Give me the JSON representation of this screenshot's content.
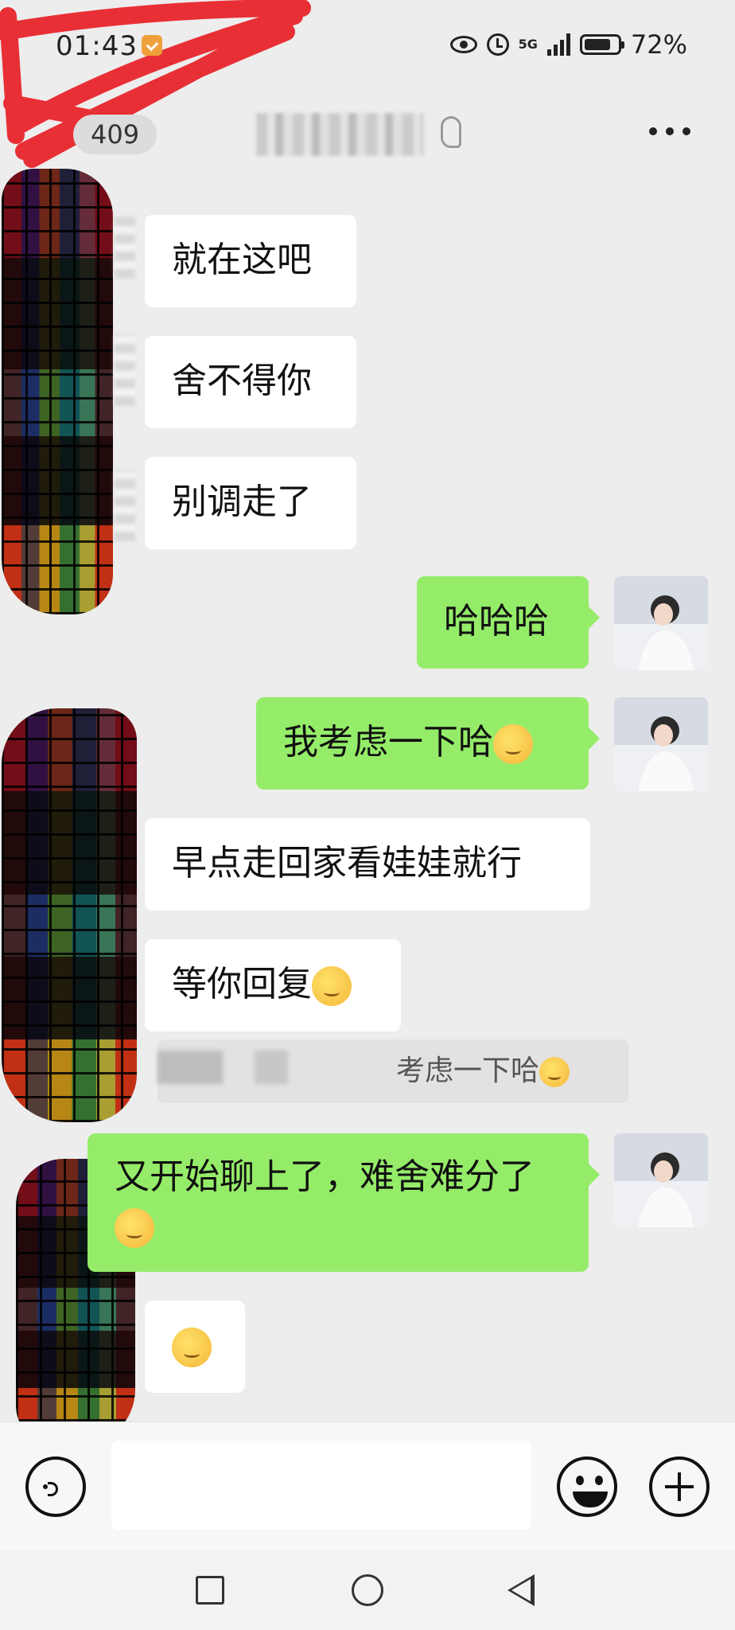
{
  "status_bar": {
    "time": "01:43",
    "network": "5G",
    "battery": "72%",
    "icons": [
      "badge-icon",
      "eye-icon",
      "alarm-icon",
      "signal-icon",
      "battery-icon"
    ]
  },
  "header": {
    "unread_count": "409",
    "icons": [
      "ear-icon",
      "more-icon"
    ]
  },
  "messages": [
    {
      "side": "left",
      "text": "就在这吧"
    },
    {
      "side": "left",
      "text": "舍不得你"
    },
    {
      "side": "left",
      "text": "别调走了"
    },
    {
      "side": "right",
      "text": "哈哈哈"
    },
    {
      "side": "right",
      "text": "我考虑一下哈",
      "emoji": "thinking-face-icon"
    },
    {
      "side": "left",
      "text": "早点走回家看娃娃就行"
    },
    {
      "side": "left",
      "text": "等你回复",
      "emoji": "thinking-face-icon"
    },
    {
      "type": "quote",
      "text": "考虑一下哈",
      "emoji": "thinking-face-icon"
    },
    {
      "side": "right",
      "text": "又开始聊上了，难舍难分了",
      "emoji": "thinking-face-icon"
    },
    {
      "side": "left",
      "text": "",
      "emoji": "crying-laughing-face-icon"
    }
  ],
  "input_bar": {
    "placeholder": "",
    "icons": [
      "voice-icon",
      "emoji-icon",
      "plus-icon"
    ]
  },
  "nav_bar": {
    "icons": [
      "recents-square-icon",
      "home-circle-icon",
      "back-triangle-icon"
    ]
  },
  "colors": {
    "background": "#ededed",
    "my_bubble": "#95ec69",
    "their_bubble": "#ffffff",
    "annotation": "#e8252b"
  }
}
